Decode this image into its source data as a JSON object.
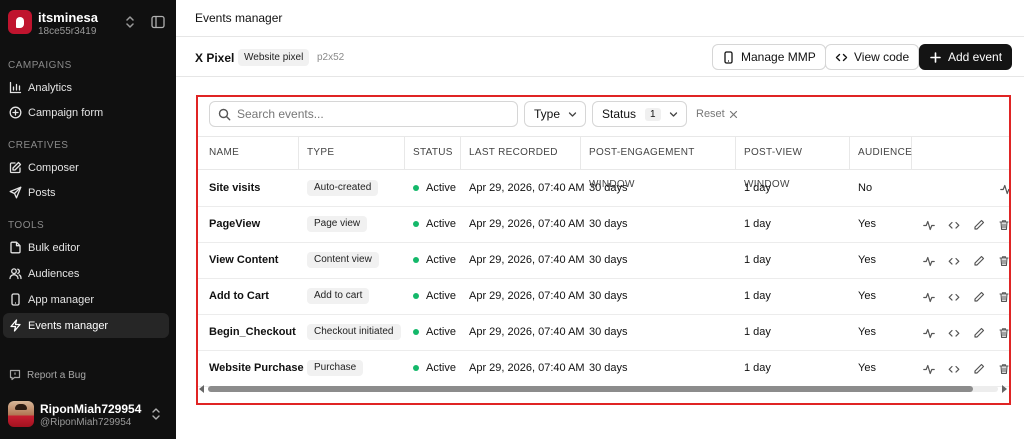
{
  "workspace": {
    "name": "itsminesa",
    "id": "18ce55r3419"
  },
  "sidebar": {
    "sections": [
      {
        "label": "CAMPAIGNS",
        "items": [
          {
            "label": "Analytics",
            "icon": "bar-chart-icon"
          },
          {
            "label": "Campaign form",
            "icon": "plus-circle-icon"
          }
        ]
      },
      {
        "label": "CREATIVES",
        "items": [
          {
            "label": "Composer",
            "icon": "edit-icon"
          },
          {
            "label": "Posts",
            "icon": "send-icon"
          }
        ]
      },
      {
        "label": "TOOLS",
        "items": [
          {
            "label": "Bulk editor",
            "icon": "file-icon"
          },
          {
            "label": "Audiences",
            "icon": "users-icon"
          },
          {
            "label": "App manager",
            "icon": "smartphone-icon"
          },
          {
            "label": "Events manager",
            "icon": "zap-icon",
            "active": true
          }
        ]
      }
    ],
    "report_bug": "Report a Bug",
    "user": {
      "name": "RiponMiah729954",
      "handle": "@RiponMiah729954"
    }
  },
  "header": {
    "title": "Events manager"
  },
  "pixel": {
    "name": "X Pixel",
    "badge": "Website pixel",
    "id": "p2x52",
    "buttons": {
      "manage_mmp": "Manage MMP",
      "view_code": "View code",
      "add_event": "Add event"
    }
  },
  "filters": {
    "search_placeholder": "Search events...",
    "type_label": "Type",
    "status_label": "Status",
    "status_count": "1",
    "reset_label": "Reset"
  },
  "table": {
    "columns": [
      "NAME",
      "TYPE",
      "STATUS",
      "LAST RECORDED",
      "POST-ENGAGEMENT WINDOW",
      "POST-VIEW WINDOW",
      "AUDIENCE"
    ],
    "rows": [
      {
        "name": "Site visits",
        "type": "Auto-created",
        "status": "Active",
        "last_recorded": "Apr 29, 2026, 07:40 AM",
        "engagement": "30 days",
        "view": "1 day",
        "audience": "No"
      },
      {
        "name": "PageView",
        "type": "Page view",
        "status": "Active",
        "last_recorded": "Apr 29, 2026, 07:40 AM",
        "engagement": "30 days",
        "view": "1 day",
        "audience": "Yes"
      },
      {
        "name": "View Content",
        "type": "Content view",
        "status": "Active",
        "last_recorded": "Apr 29, 2026, 07:40 AM",
        "engagement": "30 days",
        "view": "1 day",
        "audience": "Yes"
      },
      {
        "name": "Add to Cart",
        "type": "Add to cart",
        "status": "Active",
        "last_recorded": "Apr 29, 2026, 07:40 AM",
        "engagement": "30 days",
        "view": "1 day",
        "audience": "Yes"
      },
      {
        "name": "Begin_Checkout",
        "type": "Checkout initiated",
        "status": "Active",
        "last_recorded": "Apr 29, 2026, 07:40 AM",
        "engagement": "30 days",
        "view": "1 day",
        "audience": "Yes"
      },
      {
        "name": "Website Purchase",
        "type": "Purchase",
        "status": "Active",
        "last_recorded": "Apr 29, 2026, 07:40 AM",
        "engagement": "30 days",
        "view": "1 day",
        "audience": "Yes"
      }
    ]
  },
  "colors": {
    "accent_highlight": "#e02424",
    "status_active": "#14b86a",
    "sidebar_bg": "#101010",
    "primary_button": "#141414"
  }
}
